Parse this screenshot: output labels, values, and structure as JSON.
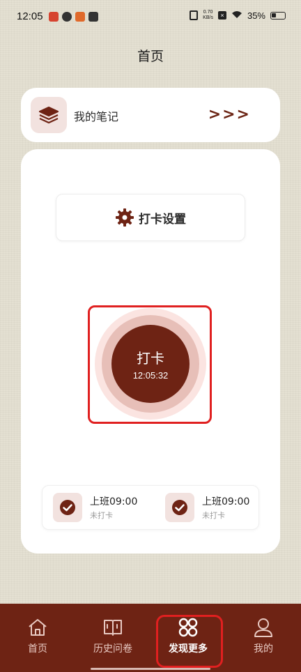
{
  "status_bar": {
    "time": "12:05",
    "net_speed_value": "0.70",
    "net_speed_unit": "KB/s",
    "battery": "35%"
  },
  "header": {
    "title": "首页"
  },
  "notes_card": {
    "label": "我的笔记",
    "arrows": ">>>"
  },
  "settings": {
    "label": "打卡设置"
  },
  "punch": {
    "label": "打卡",
    "time": "12:05:32"
  },
  "checkins": [
    {
      "title": "上班09:00",
      "status": "未打卡"
    },
    {
      "title": "上班09:00",
      "status": "未打卡"
    }
  ],
  "nav": {
    "items": [
      {
        "label": "首页",
        "icon": "home-icon"
      },
      {
        "label": "历史问卷",
        "icon": "book-icon"
      },
      {
        "label": "发现更多",
        "icon": "grid-icon",
        "active": true
      },
      {
        "label": "我的",
        "icon": "user-icon"
      }
    ]
  },
  "colors": {
    "brand": "#6e2314",
    "accent_light": "#f2e2df",
    "highlight": "#e02020",
    "background": "#e4e0d2"
  }
}
